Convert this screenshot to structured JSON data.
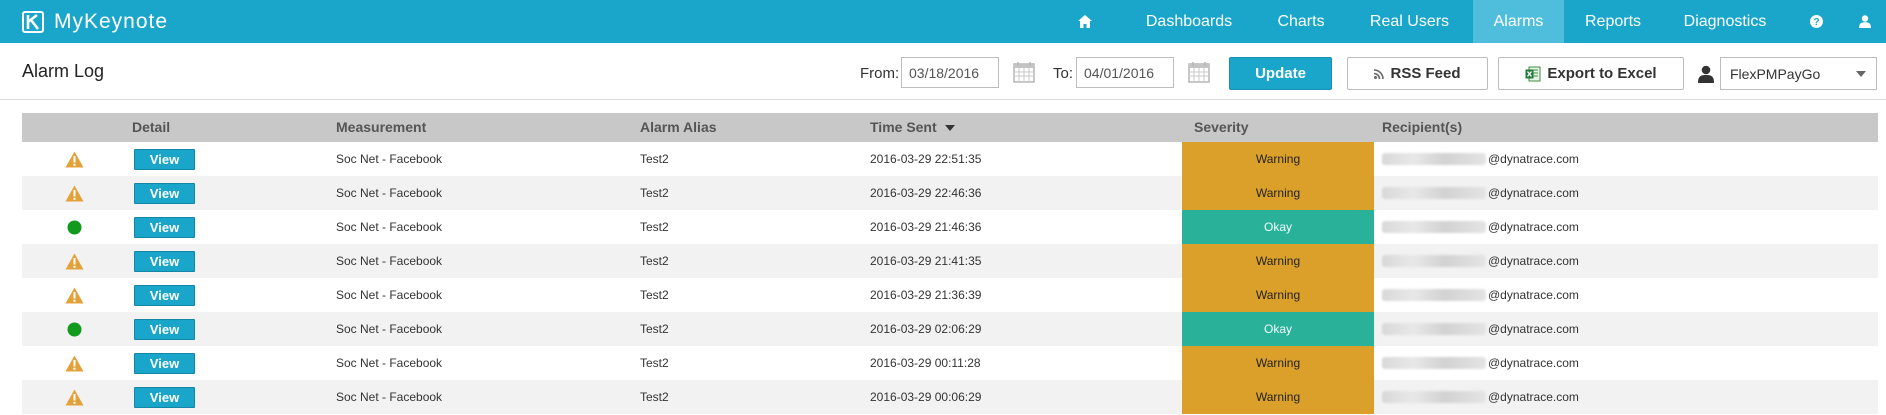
{
  "app": {
    "name": "MyKeynote"
  },
  "nav": {
    "home_icon": "home-icon",
    "items": [
      "Dashboards",
      "Charts",
      "Real Users",
      "Alarms",
      "Reports",
      "Diagnostics"
    ],
    "active": "Alarms",
    "help_icon": "help-icon",
    "user_icon": "user-icon"
  },
  "toolbar": {
    "title": "Alarm Log",
    "from_label": "From:",
    "from_value": "03/18/2016",
    "to_label": "To:",
    "to_value": "04/01/2016",
    "update_label": "Update",
    "rss_label": "RSS Feed",
    "excel_label": "Export to Excel",
    "account": "FlexPMPayGo"
  },
  "table": {
    "columns": [
      "Detail",
      "Measurement",
      "Alarm Alias",
      "Time Sent",
      "Severity",
      "Recipient(s)"
    ],
    "sort_column": "Time Sent",
    "view_label": "View",
    "rows": [
      {
        "icon": "warning",
        "measurement": "Soc Net - Facebook",
        "alias": "Test2",
        "time": "2016-03-29 22:51:35",
        "severity": "Warning",
        "recipient_domain": "@dynatrace.com"
      },
      {
        "icon": "warning",
        "measurement": "Soc Net - Facebook",
        "alias": "Test2",
        "time": "2016-03-29 22:46:36",
        "severity": "Warning",
        "recipient_domain": "@dynatrace.com"
      },
      {
        "icon": "ok",
        "measurement": "Soc Net - Facebook",
        "alias": "Test2",
        "time": "2016-03-29 21:46:36",
        "severity": "Okay",
        "recipient_domain": "@dynatrace.com"
      },
      {
        "icon": "warning",
        "measurement": "Soc Net - Facebook",
        "alias": "Test2",
        "time": "2016-03-29 21:41:35",
        "severity": "Warning",
        "recipient_domain": "@dynatrace.com"
      },
      {
        "icon": "warning",
        "measurement": "Soc Net - Facebook",
        "alias": "Test2",
        "time": "2016-03-29 21:36:39",
        "severity": "Warning",
        "recipient_domain": "@dynatrace.com"
      },
      {
        "icon": "ok",
        "measurement": "Soc Net - Facebook",
        "alias": "Test2",
        "time": "2016-03-29 02:06:29",
        "severity": "Okay",
        "recipient_domain": "@dynatrace.com"
      },
      {
        "icon": "warning",
        "measurement": "Soc Net - Facebook",
        "alias": "Test2",
        "time": "2016-03-29 00:11:28",
        "severity": "Warning",
        "recipient_domain": "@dynatrace.com"
      },
      {
        "icon": "warning",
        "measurement": "Soc Net - Facebook",
        "alias": "Test2",
        "time": "2016-03-29 00:06:29",
        "severity": "Warning",
        "recipient_domain": "@dynatrace.com"
      }
    ]
  },
  "colors": {
    "accent": "#1aa6cb",
    "warning": "#daa02a",
    "okay": "#2ab19a"
  }
}
